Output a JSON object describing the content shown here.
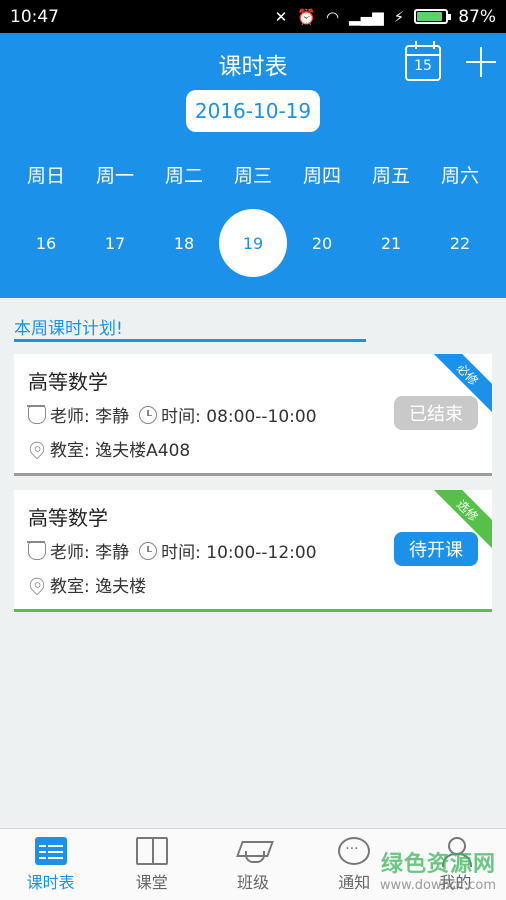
{
  "status_bar": {
    "time": "10:47",
    "battery_percent": "87%",
    "battery_level": 0.87,
    "wifi_icon": "wifi-icon",
    "signal_icon": "signal-icon"
  },
  "header": {
    "title": "课时表",
    "calendar_day": "15",
    "selected_date": "2016-10-19",
    "weekdays": [
      "周日",
      "周一",
      "周二",
      "周三",
      "周四",
      "周五",
      "周六"
    ],
    "days": [
      "16",
      "17",
      "18",
      "19",
      "20",
      "21",
      "22"
    ],
    "selected_index": 3
  },
  "section": {
    "title": "本周课时计划!"
  },
  "courses": [
    {
      "name": "高等数学",
      "teacher": "老师: 李静",
      "time": "时间: 08:00--10:00",
      "room": "教室: 逸夫楼A408",
      "status": "已结束",
      "ribbon": "必修"
    },
    {
      "name": "高等数学",
      "teacher": "老师: 李静",
      "time": "时间: 10:00--12:00",
      "room": "教室: 逸夫楼",
      "status": "待开课",
      "ribbon": "选修"
    }
  ],
  "nav": {
    "items": [
      {
        "label": "课时表",
        "icon": "schedule-icon"
      },
      {
        "label": "课堂",
        "icon": "book-icon"
      },
      {
        "label": "班级",
        "icon": "graduation-cap-icon"
      },
      {
        "label": "通知",
        "icon": "chat-icon"
      },
      {
        "label": "我的",
        "icon": "user-icon"
      }
    ]
  },
  "watermark": {
    "line1": "绿色资源网",
    "line2": "www.downcc.com"
  },
  "colors": {
    "primary": "#1b91ea",
    "ended": "#c9c9c9",
    "elective": "#56c148"
  }
}
